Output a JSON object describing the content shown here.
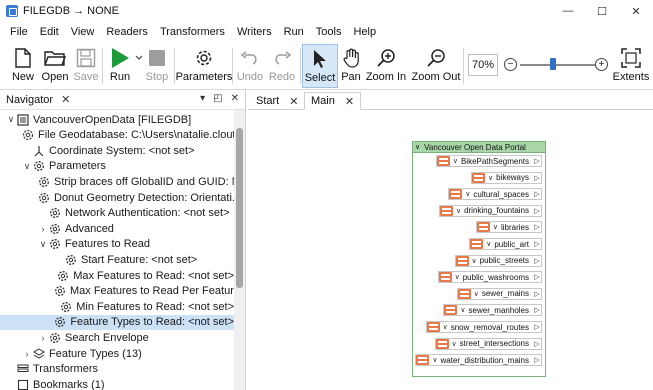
{
  "window": {
    "title": "FILEGDB → NONE",
    "controls": [
      "—",
      "☐",
      "✕"
    ]
  },
  "menu": [
    "File",
    "Edit",
    "View",
    "Readers",
    "Transformers",
    "Writers",
    "Run",
    "Tools",
    "Help"
  ],
  "toolbar": {
    "new": "New",
    "open": "Open",
    "save": "Save",
    "run": "Run",
    "stop": "Stop",
    "parameters": "Parameters",
    "undo": "Undo",
    "redo": "Redo",
    "select": "Select",
    "pan": "Pan",
    "zoom_in": "Zoom In",
    "zoom_out": "Zoom Out",
    "extents": "Extents",
    "zoom_level": "70%",
    "zoom_minus": "−",
    "zoom_plus": "+",
    "zoom_slider_fraction": 0.44
  },
  "navigator": {
    "title": "Navigator",
    "close": "✕",
    "controls": [
      "▾",
      "◰",
      "✕"
    ],
    "items": [
      {
        "label": "VancouverOpenData [FILEGDB]",
        "chev": "∨",
        "icon": "database-icon"
      },
      {
        "label": "File Geodatabase: C:\\Users\\natalie.clouth...",
        "chev": "",
        "icon": "link-icon"
      },
      {
        "label": "Coordinate System: <not set>",
        "chev": "",
        "icon": "axes-icon"
      },
      {
        "label": "Parameters",
        "chev": "∨",
        "icon": "gear-icon"
      },
      {
        "label": "Strip braces off GlobalID and GUID: No",
        "chev": "",
        "icon": "gear-icon"
      },
      {
        "label": "Donut Geometry Detection: Orientati...",
        "chev": "",
        "icon": "gear-icon"
      },
      {
        "label": "Network Authentication: <not set>",
        "chev": "",
        "icon": "gear-icon"
      },
      {
        "label": "Advanced",
        "chev": "›",
        "icon": "gear-icon"
      },
      {
        "label": "Features to Read",
        "chev": "∨",
        "icon": "gear-icon"
      },
      {
        "label": "Start Feature: <not set>",
        "chev": "",
        "icon": "gear-icon"
      },
      {
        "label": "Max Features to Read: <not set>",
        "chev": "",
        "icon": "gear-icon"
      },
      {
        "label": "Max Features to Read Per Featur...",
        "chev": "",
        "icon": "gear-icon"
      },
      {
        "label": "Min Features to Read: <not set>",
        "chev": "",
        "icon": "gear-icon"
      },
      {
        "label": "Feature Types to Read: <not set>",
        "chev": "",
        "icon": "gear-icon"
      },
      {
        "label": "Search Envelope",
        "chev": "›",
        "icon": "gear-icon"
      },
      {
        "label": "Feature Types (13)",
        "chev": "›",
        "icon": "layers-icon"
      },
      {
        "label": "Transformers",
        "chev": "",
        "icon": "stack-icon"
      },
      {
        "label": "Bookmarks (1)",
        "chev": "",
        "icon": "bookmark-icon"
      }
    ]
  },
  "tabs": [
    {
      "label": "Start",
      "close": "✕"
    },
    {
      "label": "Main",
      "close": "✕"
    }
  ],
  "reader": {
    "title": "Vancouver Open Data Portal",
    "head_chev": "∨",
    "row_chev": "∨",
    "port": "▷",
    "feature_types": [
      "BikePathSegments",
      "bikeways",
      "cultural_spaces",
      "drinking_fountains",
      "libraries",
      "public_art",
      "public_streets",
      "public_washrooms",
      "sewer_mains",
      "sewer_manholes",
      "snow_removal_routes",
      "street_intersections",
      "water_distribution_mains"
    ]
  }
}
